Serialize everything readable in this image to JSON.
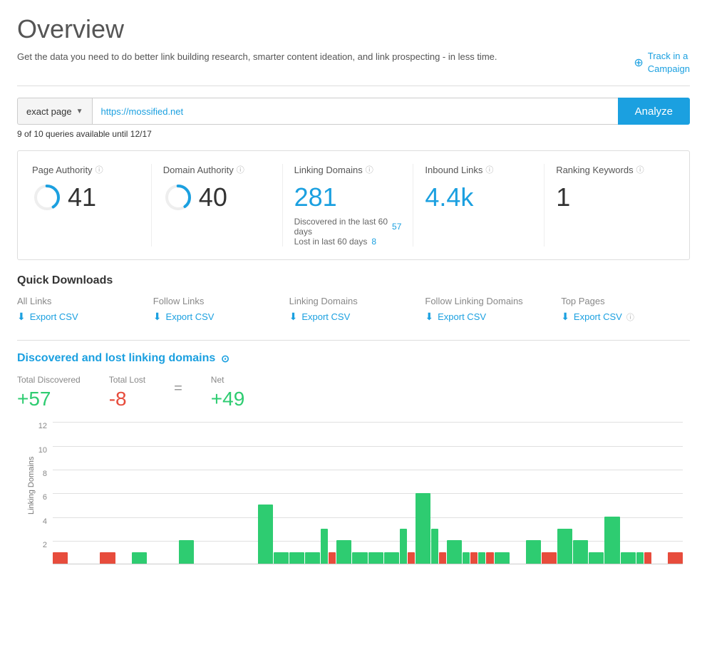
{
  "page": {
    "title": "Overview",
    "subtitle": "Get the data you need to do better link building research, smarter content ideation, and link prospecting - in less time.",
    "track_campaign_label": "Track in a\nCampaign"
  },
  "search": {
    "dropdown_label": "exact page",
    "url_value": "https://mossified.net",
    "analyze_label": "Analyze",
    "queries_text": "9 of 10 queries available until 12/17"
  },
  "metrics": [
    {
      "label": "Page Authority",
      "value": "41",
      "type": "gauge",
      "gauge_pct": 41,
      "color": "#1ba0e0"
    },
    {
      "label": "Domain Authority",
      "value": "40",
      "type": "gauge",
      "gauge_pct": 40,
      "color": "#1ba0e0"
    },
    {
      "label": "Linking Domains",
      "value": "281",
      "type": "plain_teal",
      "discovered_label": "Discovered in the last 60 days",
      "discovered_val": "57",
      "lost_label": "Lost in last 60 days",
      "lost_val": "8"
    },
    {
      "label": "Inbound Links",
      "value": "4.4k",
      "type": "plain_teal"
    },
    {
      "label": "Ranking Keywords",
      "value": "1",
      "type": "plain"
    }
  ],
  "quick_downloads": {
    "title": "Quick Downloads",
    "items": [
      {
        "category": "All Links",
        "label": "Export CSV"
      },
      {
        "category": "Follow Links",
        "label": "Export CSV"
      },
      {
        "category": "Linking Domains",
        "label": "Export CSV"
      },
      {
        "category": "Follow Linking Domains",
        "label": "Export CSV"
      },
      {
        "category": "Top Pages",
        "label": "Export CSV"
      }
    ]
  },
  "chart": {
    "title": "Discovered and lost linking domains",
    "total_discovered_label": "Total Discovered",
    "total_lost_label": "Total Lost",
    "net_label": "Net",
    "total_discovered": "+57",
    "total_lost": "-8",
    "net": "+49",
    "y_axis_labels": [
      "12",
      "10",
      "8",
      "6",
      "4",
      "2"
    ],
    "y_axis_label": "Linking Domains",
    "bars": [
      {
        "green": 0,
        "red": 1
      },
      {
        "green": 0,
        "red": 0
      },
      {
        "green": 0,
        "red": 0
      },
      {
        "green": 0,
        "red": 1
      },
      {
        "green": 0,
        "red": 0
      },
      {
        "green": 1,
        "red": 0
      },
      {
        "green": 0,
        "red": 0
      },
      {
        "green": 0,
        "red": 0
      },
      {
        "green": 2,
        "red": 0
      },
      {
        "green": 0,
        "red": 0
      },
      {
        "green": 0,
        "red": 0
      },
      {
        "green": 0,
        "red": 0
      },
      {
        "green": 0,
        "red": 0
      },
      {
        "green": 5,
        "red": 0
      },
      {
        "green": 1,
        "red": 0
      },
      {
        "green": 1,
        "red": 0
      },
      {
        "green": 1,
        "red": 0
      },
      {
        "green": 3,
        "red": 1
      },
      {
        "green": 2,
        "red": 0
      },
      {
        "green": 1,
        "red": 0
      },
      {
        "green": 1,
        "red": 0
      },
      {
        "green": 1,
        "red": 0
      },
      {
        "green": 3,
        "red": 1
      },
      {
        "green": 6,
        "red": 0
      },
      {
        "green": 3,
        "red": 1
      },
      {
        "green": 2,
        "red": 0
      },
      {
        "green": 1,
        "red": 1
      },
      {
        "green": 1,
        "red": 1
      },
      {
        "green": 1,
        "red": 0
      },
      {
        "green": 0,
        "red": 0
      },
      {
        "green": 2,
        "red": 0
      },
      {
        "green": 0,
        "red": 1
      },
      {
        "green": 3,
        "red": 0
      },
      {
        "green": 2,
        "red": 0
      },
      {
        "green": 1,
        "red": 0
      },
      {
        "green": 4,
        "red": 0
      },
      {
        "green": 1,
        "red": 0
      },
      {
        "green": 1,
        "red": 1
      },
      {
        "green": 0,
        "red": 0
      },
      {
        "green": 0,
        "red": 1
      }
    ]
  }
}
